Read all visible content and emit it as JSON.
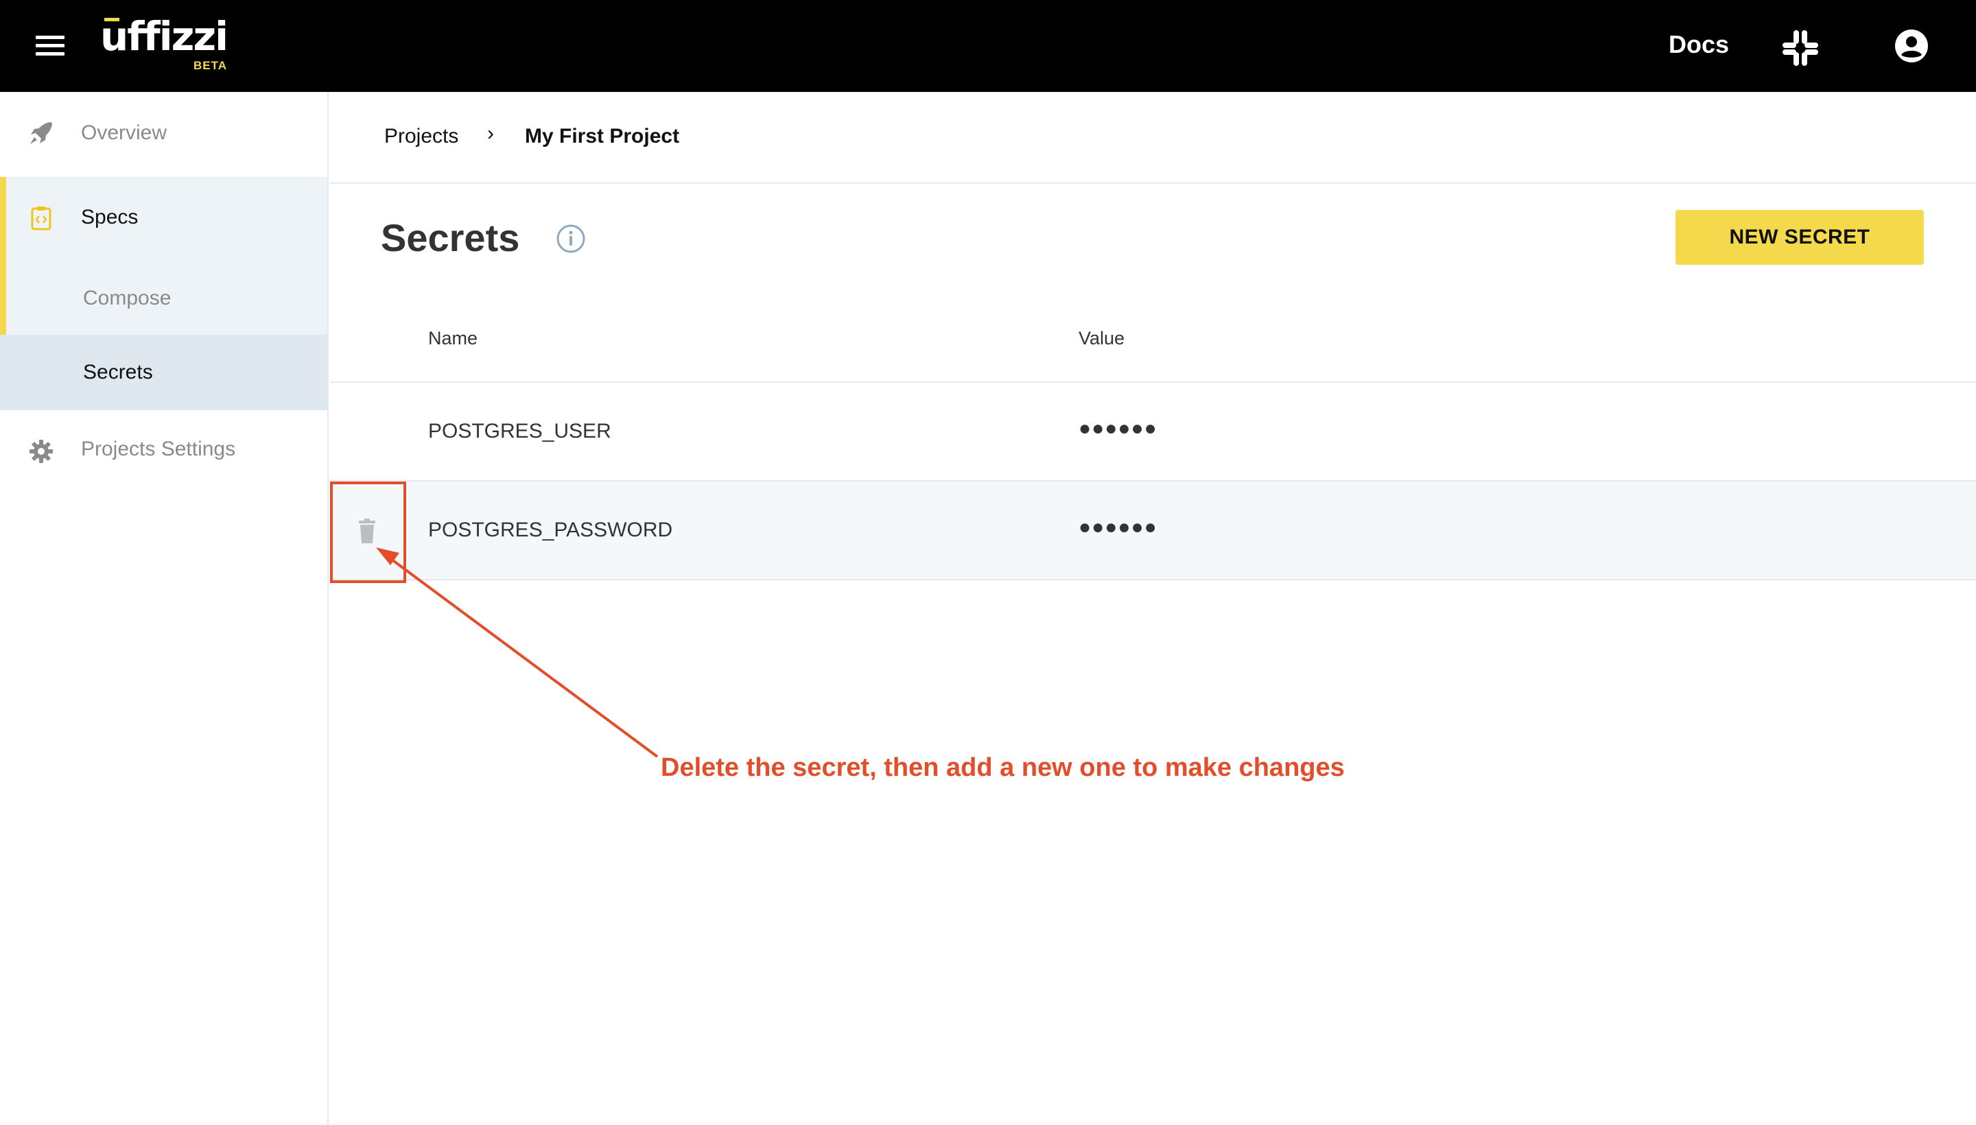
{
  "topbar": {
    "logo_text": "uffizzi",
    "logo_badge": "BETA",
    "docs_label": "Docs",
    "menu_icon": "hamburger-menu-icon",
    "slack_icon": "slack-icon",
    "account_icon": "account-circle-icon"
  },
  "sidebar": {
    "items": [
      {
        "label": "Overview",
        "icon": "rocket-icon"
      },
      {
        "label": "Specs",
        "icon": "code-file-icon"
      },
      {
        "label": "Compose"
      },
      {
        "label": "Secrets"
      },
      {
        "label": "Projects Settings",
        "icon": "gear-icon"
      }
    ],
    "accent_color": "#f5d94c"
  },
  "breadcrumb": {
    "root": "Projects",
    "separator": "›",
    "current": "My First Project"
  },
  "page": {
    "title": "Secrets",
    "new_button": "NEW SECRET",
    "button_color": "#f5d94c"
  },
  "table": {
    "columns": [
      "Name",
      "Value"
    ],
    "rows": [
      {
        "name": "POSTGRES_USER",
        "value": "●●●●●●"
      },
      {
        "name": "POSTGRES_PASSWORD",
        "value": "●●●●●●"
      }
    ]
  },
  "annotation": {
    "text": "Delete the secret, then add a new one to make changes",
    "color": "#e24d2a"
  }
}
